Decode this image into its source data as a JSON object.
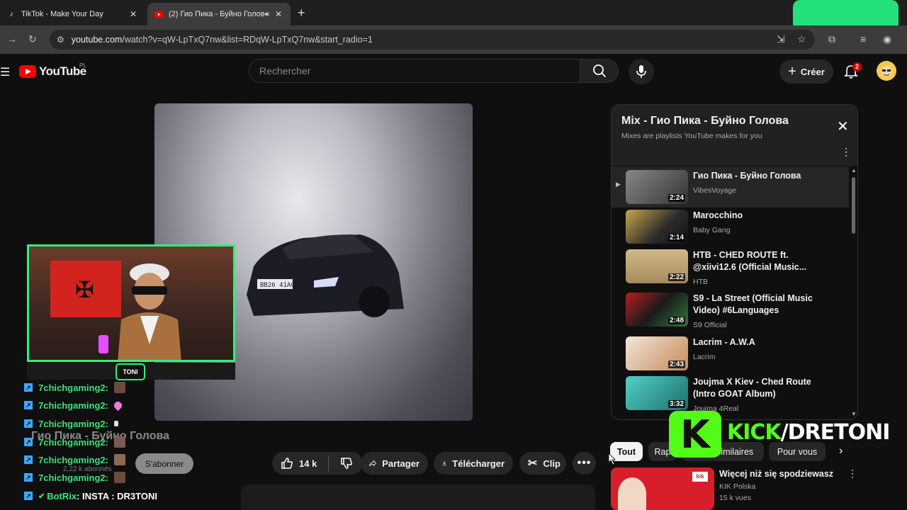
{
  "browser": {
    "tabs": [
      {
        "title": "TikTok - Make Your Day",
        "favicon": "tiktok-icon"
      },
      {
        "title": "(2) Гио Пика - Буйно Голова",
        "favicon": "youtube-icon",
        "audio": true
      }
    ],
    "url_domain": "youtube.com",
    "url_path": "/watch?v=qW-LpTxQ7nw&list=RDqW-LpTxQ7nw&start_radio=1"
  },
  "header": {
    "logo": "YouTube",
    "country": "PL",
    "search_placeholder": "Rechercher",
    "create_label": "Créer",
    "notifications": "2"
  },
  "video": {
    "title": "Гио Пика - Буйно Голова",
    "channel_subs": "2,22 k abonnés",
    "subscribe_label": "S'abonner",
    "likes": "14 k",
    "share_label": "Partager",
    "download_label": "Télécharger",
    "clip_label": "Clip"
  },
  "stream_overlay": {
    "webcam_tag": "TONI",
    "chat": [
      {
        "user": "7chichgaming2",
        "sep": " :"
      },
      {
        "user": "7chichgaming2",
        "sep": " :"
      },
      {
        "user": "7chichgaming2",
        "sep": " :"
      },
      {
        "user": "7chichgaming2",
        "sep": " :"
      },
      {
        "user": "7chichgaming2",
        "sep": " :"
      },
      {
        "user": "7chichgaming2",
        "sep": " :"
      },
      {
        "user": "7chichgaming2",
        "sep": " :"
      }
    ],
    "bot_line": {
      "user": "BotRix",
      "message": " : INSTA : DR3TONI"
    },
    "kick_brand": "KICK",
    "kick_handle": "/DRETONI",
    "kick_color": "#53fc18"
  },
  "playlist": {
    "title": "Mix - Гио Пика - Буйно Голова",
    "subtitle": "Mixes are playlists YouTube makes for you",
    "items": [
      {
        "title": "Гио Пика - Буйно Голова",
        "channel": "VibesVoyage",
        "duration": "2:24"
      },
      {
        "title": "Marocchino",
        "channel": "Baby Gang",
        "duration": "2:14"
      },
      {
        "title": "HTB - CHED ROUTE ft. @xiivi12.6 (Official Music...",
        "channel": "HTB",
        "duration": "2:22"
      },
      {
        "title": "S9 - La Street (Official Music Video) #6Languages",
        "channel": "S9 Official",
        "duration": "2:48"
      },
      {
        "title": "Lacrim - A.W.A",
        "channel": "Lacrim",
        "duration": "2:43"
      },
      {
        "title": "Joujma X Kiev - Ched Route (Intro GOAT Album)",
        "channel": "Joujma 4Real",
        "duration": "3:32"
      }
    ]
  },
  "chips": [
    "Tout",
    "Rap",
    "Titres similaires",
    "Pour vous"
  ],
  "suggested": {
    "title": "Więcej niż się spodziewasz",
    "channel": "KIK Polska",
    "views": "15 k vues"
  }
}
